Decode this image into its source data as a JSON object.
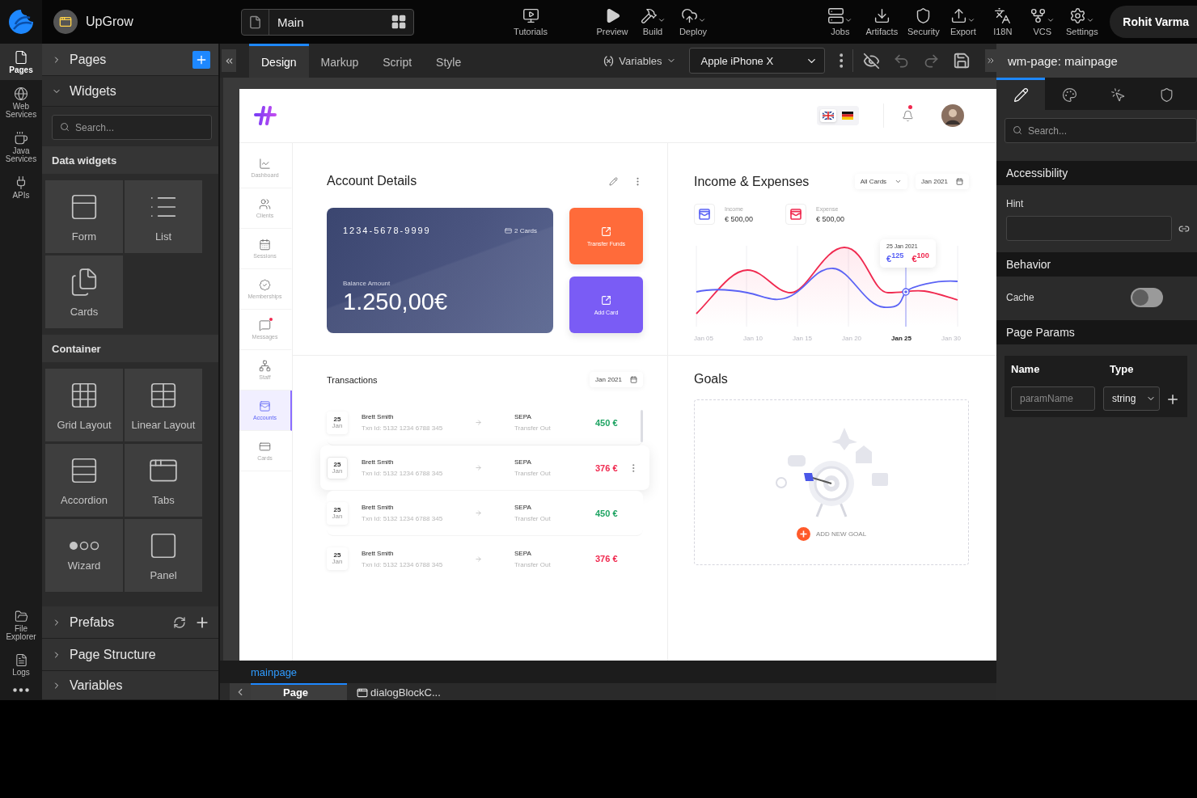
{
  "topbar": {
    "project": "UpGrow",
    "page_selector": "Main",
    "tools": [
      {
        "label": "Tutorials",
        "menu": false
      },
      {
        "label": "Preview",
        "menu": false
      },
      {
        "label": "Build",
        "menu": true
      },
      {
        "label": "Deploy",
        "menu": true
      }
    ],
    "actions": [
      {
        "label": "Jobs",
        "menu": true
      },
      {
        "label": "Artifacts",
        "menu": false
      },
      {
        "label": "Security",
        "menu": false
      },
      {
        "label": "Export",
        "menu": true
      },
      {
        "label": "I18N",
        "menu": false
      },
      {
        "label": "VCS",
        "menu": true
      },
      {
        "label": "Settings",
        "menu": true
      }
    ],
    "user": "Rohit Varma"
  },
  "rail": {
    "items": [
      {
        "label": "Pages",
        "selected": true
      },
      {
        "label": "Web Services",
        "selected": false
      },
      {
        "label": "Java Services",
        "selected": false
      },
      {
        "label": "APIs",
        "selected": false
      }
    ],
    "bottom_items": [
      "File Explorer",
      "Logs"
    ]
  },
  "left_panel": {
    "pages": {
      "label": "Pages",
      "expanded": false
    },
    "widgets": {
      "label": "Widgets",
      "expanded": true,
      "search": {
        "placeholder": "Search..."
      },
      "groups": [
        {
          "title": "Data widgets",
          "items": [
            "Form",
            "List",
            "Cards"
          ]
        },
        {
          "title": "Container",
          "items": [
            "Grid Layout",
            "Linear Layout",
            "Accordion",
            "Tabs",
            "Wizard",
            "Panel"
          ]
        }
      ]
    },
    "sections": [
      {
        "label": "Prefabs",
        "expanded": false
      },
      {
        "label": "Page Structure",
        "expanded": false
      },
      {
        "label": "Variables",
        "expanded": false
      }
    ]
  },
  "editor": {
    "tabs": [
      {
        "label": "Design",
        "selected": true
      },
      {
        "label": "Markup",
        "selected": false
      },
      {
        "label": "Script",
        "selected": false
      },
      {
        "label": "Style",
        "selected": false
      }
    ],
    "variables": "Variables",
    "device": "Apple iPhone X"
  },
  "app": {
    "flags": [
      {
        "selected": true
      },
      {
        "selected": false
      }
    ],
    "notification": true,
    "nav": [
      {
        "label": "Dashboard",
        "selected": false,
        "alert": false
      },
      {
        "label": "Clients",
        "selected": false,
        "alert": false
      },
      {
        "label": "Sessions",
        "selected": false,
        "alert": false
      },
      {
        "label": "Memberships",
        "selected": false,
        "alert": false
      },
      {
        "label": "Messages",
        "selected": false,
        "alert": true
      },
      {
        "label": "Staff",
        "selected": false,
        "alert": false
      },
      {
        "label": "Accounts",
        "selected": true,
        "alert": false
      },
      {
        "label": "Cards",
        "selected": false,
        "alert": false
      }
    ],
    "account": {
      "title": "Account Details",
      "card_number": "1234-5678-9999",
      "cards_count": "2 Cards",
      "balance_label": "Balance Amount",
      "balance": "1.250,00€",
      "actions": [
        {
          "label": "Transfer Funds",
          "color": "#ff6b3a"
        },
        {
          "label": "Add Card",
          "color": "#7a5cf5"
        }
      ]
    },
    "transactions": {
      "title": "Transactions",
      "period": "Jan 2021",
      "rows": [
        {
          "day": "25",
          "month": "Jan",
          "name": "Brett Smith",
          "txn": "Txn Id: 5132 1234 6788 345",
          "method": "SEPA",
          "type": "Transfer Out",
          "amount": "450 €",
          "color": "#1fa463",
          "selected": false
        },
        {
          "day": "25",
          "month": "Jan",
          "name": "Brett Smith",
          "txn": "Txn Id: 5132 1234 6788 345",
          "method": "SEPA",
          "type": "Transfer Out",
          "amount": "376 €",
          "color": "#f0294f",
          "selected": true
        },
        {
          "day": "25",
          "month": "Jan",
          "name": "Brett Smith",
          "txn": "Txn Id: 5132 1234 6788 345",
          "method": "SEPA",
          "type": "Transfer Out",
          "amount": "450 €",
          "color": "#1fa463",
          "selected": false
        },
        {
          "day": "25",
          "month": "Jan",
          "name": "Brett Smith",
          "txn": "Txn Id: 5132 1234 6788 345",
          "method": "SEPA",
          "type": "Transfer Out",
          "amount": "376 €",
          "color": "#f0294f",
          "selected": false
        }
      ]
    },
    "income": {
      "title": "Income & Expenses",
      "filter": "All Cards",
      "period": "Jan 2021",
      "stats": [
        {
          "label": "Income",
          "value": "€ 500,00",
          "color": "#5b63f5"
        },
        {
          "label": "Expense",
          "value": "€ 500,00",
          "color": "#f0294f"
        }
      ],
      "tooltip": {
        "date": "25 Jan 2021",
        "values": [
          {
            "value": "€$^{125}$",
            "color": "#5b63f5"
          },
          {
            "value": "€$^{100}$",
            "color": "#f0294f"
          }
        ]
      },
      "x_labels": [
        {
          "label": "Jan 05",
          "selected": false
        },
        {
          "label": "Jan 10",
          "selected": false
        },
        {
          "label": "Jan 15",
          "selected": false
        },
        {
          "label": "Jan 20",
          "selected": false
        },
        {
          "label": "Jan 25",
          "selected": true
        },
        {
          "label": "Jan 30",
          "selected": false
        }
      ]
    },
    "goals": {
      "title": "Goals",
      "action": "ADD NEW GOAL"
    }
  },
  "footer": {
    "breadcrumb": "mainpage",
    "tabs": [
      {
        "label": "Page",
        "selected": true
      },
      {
        "label": "dialogBlockC...",
        "selected": false
      }
    ]
  },
  "properties": {
    "title": "wm-page: mainpage",
    "tabs": [
      {
        "selected": true
      },
      {
        "selected": false
      },
      {
        "selected": false
      },
      {
        "selected": false
      }
    ],
    "search": {
      "placeholder": "Search..."
    },
    "accessibility": {
      "title": "Accessibility",
      "hint_label": "Hint"
    },
    "behavior": {
      "title": "Behavior",
      "cache_label": "Cache",
      "cache_on": false
    },
    "page_params": {
      "title": "Page Params",
      "columns": [
        "Name",
        "Type"
      ],
      "name_placeholder": "paramName",
      "type_value": "string"
    }
  }
}
